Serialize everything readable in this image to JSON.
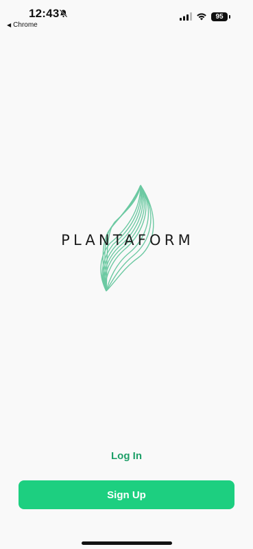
{
  "status_bar": {
    "time": "12:43",
    "back_label": "Chrome",
    "battery_level": "95"
  },
  "logo": {
    "wordmark": "PLANTAFORM",
    "mark_color": "#6cc9a2"
  },
  "actions": {
    "login_label": "Log In",
    "signup_label": "Sign Up"
  },
  "colors": {
    "accent": "#1dcf80",
    "link": "#1e9f68",
    "background": "#f9f9f9"
  },
  "icons": [
    "bell-slash-icon",
    "back-arrow-icon",
    "signal-icon",
    "wifi-icon",
    "battery-icon"
  ]
}
